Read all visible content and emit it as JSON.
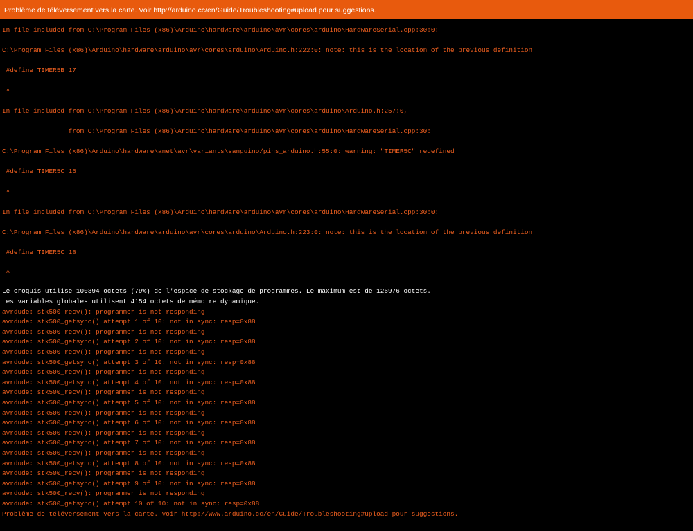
{
  "status_bar": {
    "message": "Problème de téléversement vers la carte. Voir http://arduino.cc/en/Guide/Troubleshooting#upload pour suggestions."
  },
  "colors": {
    "status_bar_bg": "#e85a0d",
    "console_bg": "#000000",
    "error_text": "#ee5f1f",
    "output_text": "#ffffff"
  },
  "console": {
    "lines": [
      {
        "type": "err",
        "spacing": "tall",
        "text": "In file included from C:\\Program Files (x86)\\Arduino\\hardware\\arduino\\avr\\cores\\arduino\\HardwareSerial.cpp:30:0:"
      },
      {
        "type": "err",
        "spacing": "tall",
        "text": "C:\\Program Files (x86)\\Arduino\\hardware\\arduino\\avr\\cores\\arduino\\Arduino.h:222:0: note: this is the location of the previous definition"
      },
      {
        "type": "err",
        "spacing": "tall",
        "text": " #define TIMER5B 17"
      },
      {
        "type": "err",
        "spacing": "tall",
        "text": " ^"
      },
      {
        "type": "err",
        "spacing": "tall",
        "text": "In file included from C:\\Program Files (x86)\\Arduino\\hardware\\arduino\\avr\\cores\\arduino\\Arduino.h:257:0,"
      },
      {
        "type": "err",
        "spacing": "tall",
        "text": "                 from C:\\Program Files (x86)\\Arduino\\hardware\\arduino\\avr\\cores\\arduino\\HardwareSerial.cpp:30:"
      },
      {
        "type": "err",
        "spacing": "tall",
        "text": "C:\\Program Files (x86)\\Arduino\\hardware\\anet\\avr\\variants\\sanguino/pins_arduino.h:55:0: warning: \"TIMER5C\" redefined"
      },
      {
        "type": "err",
        "spacing": "tall",
        "text": " #define TIMER5C 16"
      },
      {
        "type": "err",
        "spacing": "tall",
        "text": " ^"
      },
      {
        "type": "err",
        "spacing": "tall",
        "text": "In file included from C:\\Program Files (x86)\\Arduino\\hardware\\arduino\\avr\\cores\\arduino\\HardwareSerial.cpp:30:0:"
      },
      {
        "type": "err",
        "spacing": "tall",
        "text": "C:\\Program Files (x86)\\Arduino\\hardware\\arduino\\avr\\cores\\arduino\\Arduino.h:223:0: note: this is the location of the previous definition"
      },
      {
        "type": "err",
        "spacing": "tall",
        "text": " #define TIMER5C 18"
      },
      {
        "type": "err",
        "spacing": "tall",
        "text": " ^"
      },
      {
        "type": "out",
        "spacing": "tight",
        "text": "Le croquis utilise 100394 octets (79%) de l'espace de stockage de programmes. Le maximum est de 126976 octets."
      },
      {
        "type": "out",
        "spacing": "tight",
        "text": "Les variables globales utilisent 4154 octets de mémoire dynamique."
      },
      {
        "type": "err",
        "spacing": "tight",
        "text": "avrdude: stk500_recv(): programmer is not responding"
      },
      {
        "type": "err",
        "spacing": "tight",
        "text": "avrdude: stk500_getsync() attempt 1 of 10: not in sync: resp=0x88"
      },
      {
        "type": "err",
        "spacing": "tight",
        "text": "avrdude: stk500_recv(): programmer is not responding"
      },
      {
        "type": "err",
        "spacing": "tight",
        "text": "avrdude: stk500_getsync() attempt 2 of 10: not in sync: resp=0x88"
      },
      {
        "type": "err",
        "spacing": "tight",
        "text": "avrdude: stk500_recv(): programmer is not responding"
      },
      {
        "type": "err",
        "spacing": "tight",
        "text": "avrdude: stk500_getsync() attempt 3 of 10: not in sync: resp=0x88"
      },
      {
        "type": "err",
        "spacing": "tight",
        "text": "avrdude: stk500_recv(): programmer is not responding"
      },
      {
        "type": "err",
        "spacing": "tight",
        "text": "avrdude: stk500_getsync() attempt 4 of 10: not in sync: resp=0x88"
      },
      {
        "type": "err",
        "spacing": "tight",
        "text": "avrdude: stk500_recv(): programmer is not responding"
      },
      {
        "type": "err",
        "spacing": "tight",
        "text": "avrdude: stk500_getsync() attempt 5 of 10: not in sync: resp=0x88"
      },
      {
        "type": "err",
        "spacing": "tight",
        "text": "avrdude: stk500_recv(): programmer is not responding"
      },
      {
        "type": "err",
        "spacing": "tight",
        "text": "avrdude: stk500_getsync() attempt 6 of 10: not in sync: resp=0x88"
      },
      {
        "type": "err",
        "spacing": "tight",
        "text": "avrdude: stk500_recv(): programmer is not responding"
      },
      {
        "type": "err",
        "spacing": "tight",
        "text": "avrdude: stk500_getsync() attempt 7 of 10: not in sync: resp=0x88"
      },
      {
        "type": "err",
        "spacing": "tight",
        "text": "avrdude: stk500_recv(): programmer is not responding"
      },
      {
        "type": "err",
        "spacing": "tight",
        "text": "avrdude: stk500_getsync() attempt 8 of 10: not in sync: resp=0x88"
      },
      {
        "type": "err",
        "spacing": "tight",
        "text": "avrdude: stk500_recv(): programmer is not responding"
      },
      {
        "type": "err",
        "spacing": "tight",
        "text": "avrdude: stk500_getsync() attempt 9 of 10: not in sync: resp=0x88"
      },
      {
        "type": "err",
        "spacing": "tight",
        "text": "avrdude: stk500_recv(): programmer is not responding"
      },
      {
        "type": "err",
        "spacing": "tight",
        "text": "avrdude: stk500_getsync() attempt 10 of 10: not in sync: resp=0x88"
      },
      {
        "type": "err",
        "spacing": "tight",
        "text": "Problème de téléversement vers la carte. Voir http://www.arduino.cc/en/Guide/Troubleshooting#upload pour suggestions."
      }
    ]
  }
}
